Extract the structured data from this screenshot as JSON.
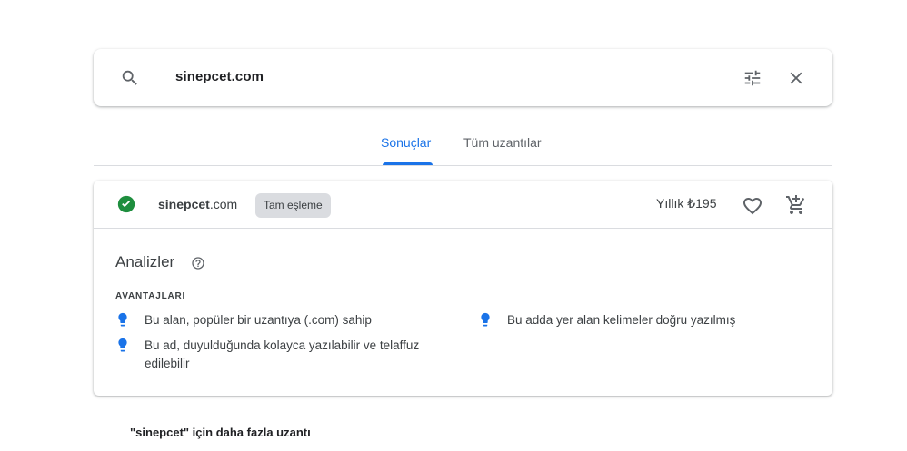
{
  "search": {
    "query": "sinepcet.com"
  },
  "tabs": [
    {
      "label": "Sonuçlar",
      "active": true
    },
    {
      "label": "Tüm uzantılar",
      "active": false
    }
  ],
  "result": {
    "domain_name": "sinepcet",
    "domain_tld": ".com",
    "match_badge": "Tam eşleme",
    "price": "Yıllık ₺195",
    "status": "available"
  },
  "insights": {
    "title": "Analizler",
    "advantages_label": "AVANTAJLARI",
    "advantages": [
      "Bu alan, popüler bir uzantıya (.com) sahip",
      "Bu ad, duyulduğunda kolayca yazılabilir ve telaffuz edilebilir",
      "Bu adda yer alan kelimeler doğru yazılmış"
    ]
  },
  "more_section": {
    "title": "\"sinepcet\" için daha fazla uzantı"
  },
  "colors": {
    "accent": "#1a73e8",
    "success": "#1e8e3e",
    "text": "#202124",
    "muted": "#5f6368",
    "divider": "#dadce0"
  },
  "icons": [
    "search-icon",
    "filter-icon",
    "close-icon",
    "check-circle-icon",
    "heart-icon",
    "add-cart-icon",
    "help-icon",
    "lightbulb-icon"
  ]
}
